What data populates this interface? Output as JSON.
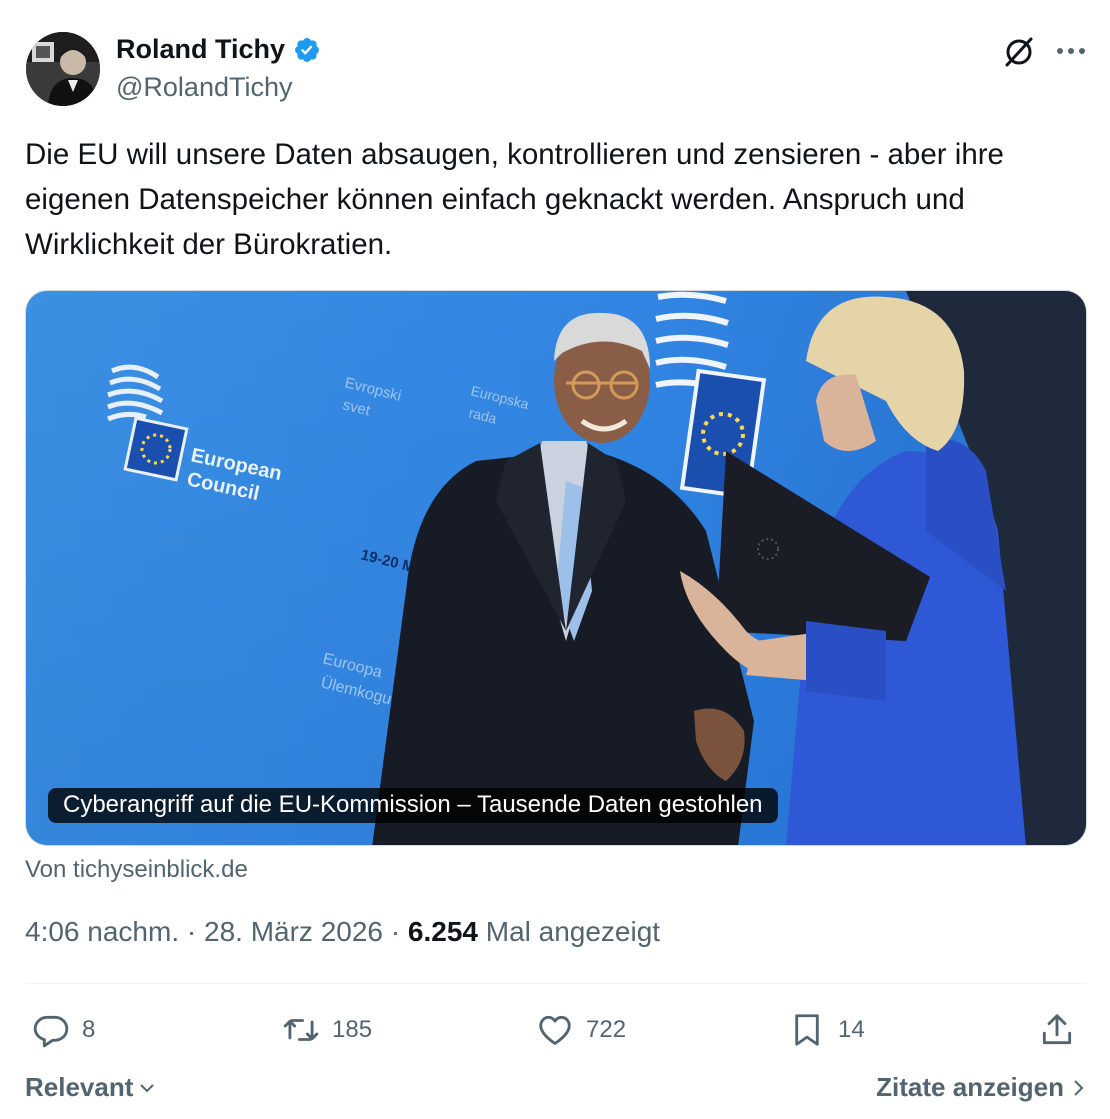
{
  "author": {
    "name": "Roland Tichy",
    "handle": "@RolandTichy",
    "verified": true,
    "verified_color": "#1d9bf0"
  },
  "tweet": {
    "text": "Die EU will unsere Daten absaugen, kontrollieren und zensieren - aber ihre eigenen Datenspeicher können einfach geknackt werden. Anspruch und Wirklichkeit der Bürokratien."
  },
  "link_card": {
    "caption": "Cyberangriff auf die EU-Kommission – Tausende Daten gestohlen",
    "source": "Von tichyseinblick.de",
    "image_text": {
      "logo_line1": "European",
      "logo_line2": "Council",
      "sign_1a": "Evropski",
      "sign_1b": "svet",
      "sign_2a": "Europska",
      "sign_2b": "rada",
      "date_text": "19-20 Mar",
      "sign_3a": "Euroopa",
      "sign_3b": "Ülemkogu"
    }
  },
  "meta": {
    "time": "4:06 nachm.",
    "separator": "·",
    "date": "28. März 2026",
    "views": "6.254",
    "views_label": "Mal angezeigt"
  },
  "actions": {
    "replies": "8",
    "reposts": "185",
    "likes": "722",
    "bookmarks": "14"
  },
  "footer": {
    "sort_label": "Relevant",
    "quotes_label": "Zitate anzeigen"
  },
  "colors": {
    "text": "#0f1419",
    "secondary": "#536471",
    "accent": "#1d9bf0"
  },
  "icons": [
    "grok-icon",
    "more-icon",
    "reply-icon",
    "repost-icon",
    "like-icon",
    "bookmark-icon",
    "share-icon",
    "chevron-down-icon",
    "chevron-right-icon"
  ]
}
